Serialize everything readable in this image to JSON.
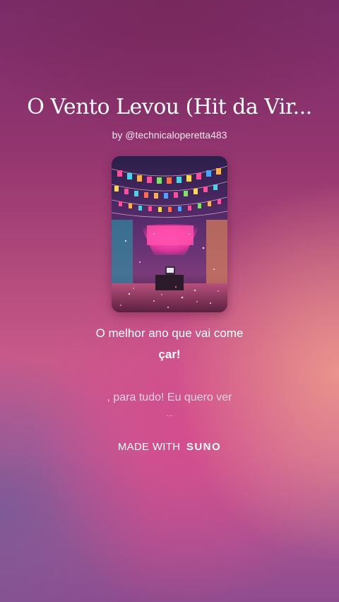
{
  "song": {
    "title": "O Vento Levou (Hit da Vir...",
    "author": "by @technicaloperetta483"
  },
  "cover": {
    "alt_icon": "party-scene-cover-art"
  },
  "lyrics": {
    "line1": "O melhor ano que vai come",
    "line2": "çar!",
    "line3": ", para tudo! Eu quero ver",
    "line4": "..."
  },
  "footer": {
    "made_with": "MADE WITH",
    "brand": "SUNO"
  },
  "colors": {
    "background_top": "#7a2c6a",
    "background_accent": "#d64a8c",
    "background_warm": "#ec968c",
    "text": "#ffffff"
  }
}
